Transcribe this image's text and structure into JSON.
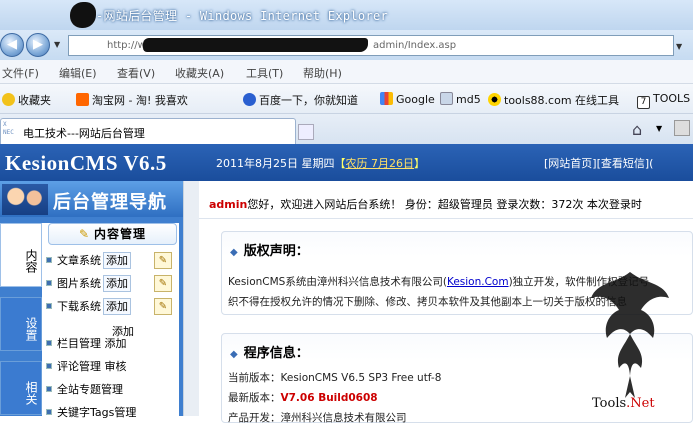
{
  "window": {
    "title": "-网站后台管理 - Windows Internet Explorer"
  },
  "address": {
    "prefix": "http://www.",
    "value": "admin/Index.asp"
  },
  "menu": [
    "文件(F)",
    "编辑(E)",
    "查看(V)",
    "收藏夹(A)",
    "工具(T)",
    "帮助(H)"
  ],
  "favorites": [
    "收藏夹",
    "淘宝网 - 淘! 我喜欢",
    "百度一下，你就知道",
    "Google",
    "md5",
    "tools88.com 在线工具",
    "TOOLS -"
  ],
  "tab": {
    "icon_text": "X NEC",
    "label": "电工技术---网站后台管理"
  },
  "header": {
    "logo": "KesionCMS V6.5",
    "date": "2011年8月25日 星期四",
    "lunar": "农历 7月26日",
    "links": "[网站首页][查看短信]("
  },
  "sidebar": {
    "title": "后台管理导航",
    "tabs": [
      "内容",
      "设置",
      "相关"
    ],
    "section": "内容管理",
    "items": [
      {
        "label": "文章系统",
        "add": "添加"
      },
      {
        "label": "图片系统",
        "add": "添加"
      },
      {
        "label": "下载系统",
        "add": "添加"
      }
    ],
    "add_link": "添加",
    "links": [
      "栏目管理 添加",
      "评论管理 审核",
      "全站专题管理",
      "关键字Tags管理"
    ]
  },
  "main": {
    "welcome_user": "admin",
    "welcome_text": "您好，欢迎进入网站后台系统！ 身份：超级管理员 登录次数：372次 本次登录时",
    "copyright": {
      "title": "版权声明：",
      "line1": "KesionCMS系统由漳州科兴信息技术有限公司(",
      "link": "Kesion.Com",
      "line1b": ")独立开发，软件制作权登记号",
      "line2": "织不得在授权允许的情况下删除、修改、拷贝本软件及其他副本上一切关于版权的信息"
    },
    "program": {
      "title": "程序信息：",
      "current_label": "当前版本：",
      "current": "KesionCMS V6.5 SP3 Free utf-8",
      "latest_label": "最新版本：",
      "latest": "V7.06 Build0608",
      "row3": "产品开发：漳州科兴信息技术有限公司"
    }
  },
  "watermark": {
    "text_dark": "T",
    "text_mid": "ools",
    "text_red": ".Net"
  }
}
